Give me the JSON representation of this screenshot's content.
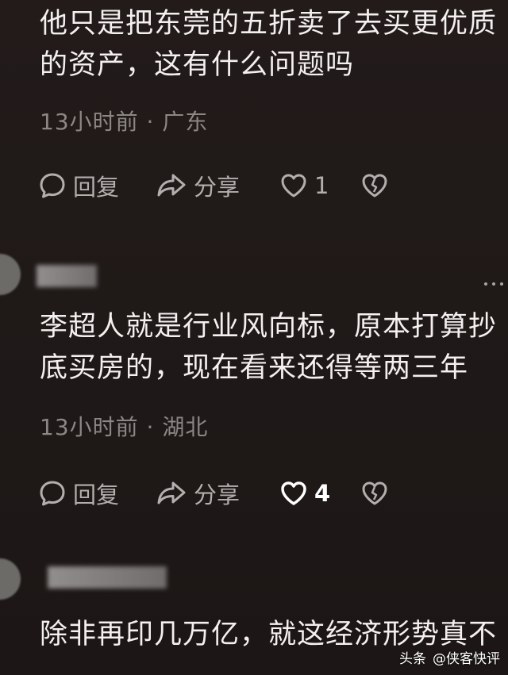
{
  "comments": [
    {
      "lines": [
        "他只是把东莞的五折卖了去买更优质",
        "的资产，这有什么问题吗"
      ],
      "time": "13小时前",
      "location": "广东",
      "reply_label": "回复",
      "share_label": "分享",
      "likes": "1",
      "liked": false
    },
    {
      "lines": [
        "李超人就是行业风向标，原本打算抄",
        "底买房的，现在看来还得等两三年"
      ],
      "time": "13小时前",
      "location": "湖北",
      "reply_label": "回复",
      "share_label": "分享",
      "likes": "4",
      "liked": true
    },
    {
      "lines": [
        "除非再印几万亿，就这经济形势真不"
      ]
    }
  ],
  "meta_separator": "·",
  "watermark": {
    "brand": "头条",
    "account": "@侠客快评"
  },
  "icons": {
    "reply": "speech-bubble-icon",
    "share": "share-arrow-icon",
    "like": "heart-icon",
    "dislike": "broken-heart-icon",
    "more": "more-dots-icon"
  }
}
